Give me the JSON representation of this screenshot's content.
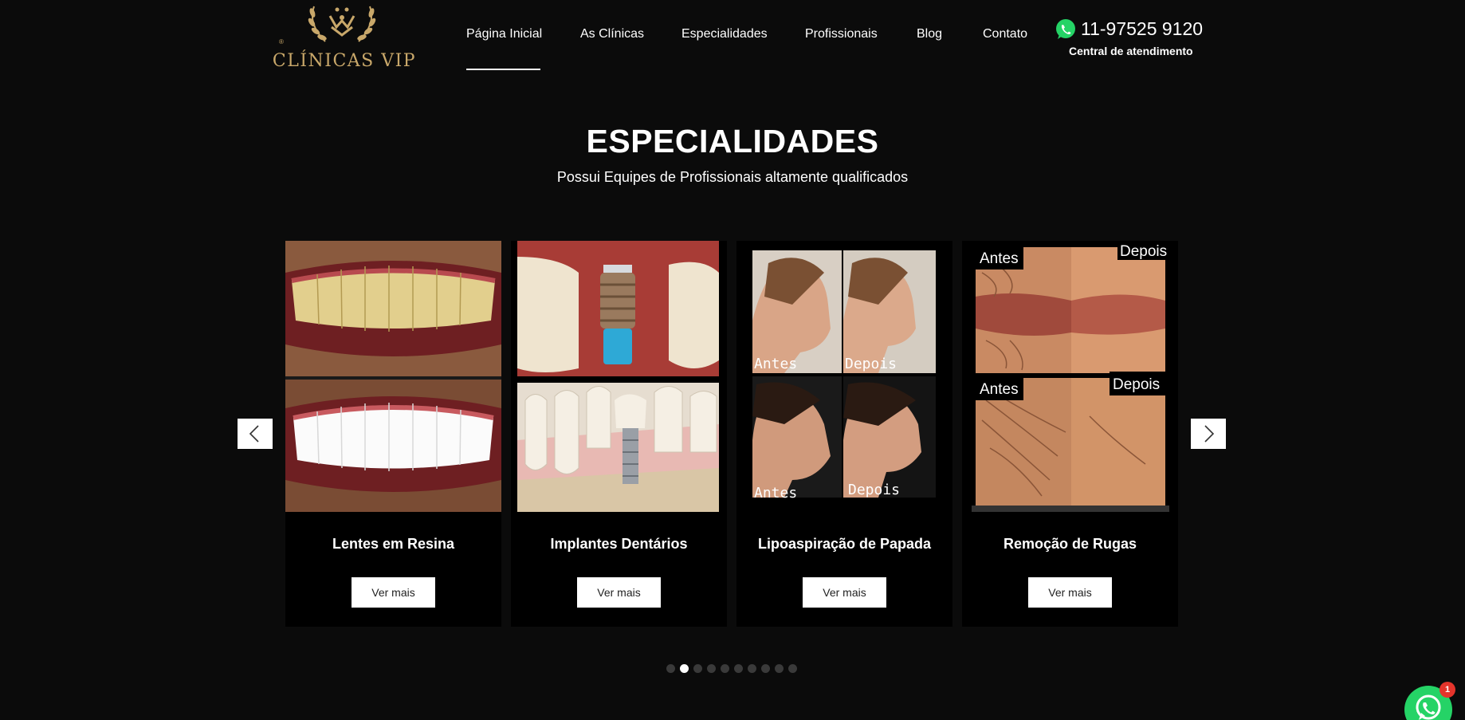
{
  "header": {
    "logo_text": "CLÍNICAS VIP",
    "logo_reg": "®",
    "nav": [
      {
        "label": "Página Inicial",
        "active": true
      },
      {
        "label": "As Clínicas",
        "active": false
      },
      {
        "label": "Especialidades",
        "active": false
      },
      {
        "label": "Profissionais",
        "active": false
      },
      {
        "label": "Blog",
        "active": false
      },
      {
        "label": "Contato",
        "active": false
      }
    ],
    "phone": "11-97525 9120",
    "phone_caption": "Central de atendimento"
  },
  "section": {
    "title": "ESPECIALIDADES",
    "subtitle": "Possui Equipes de Profissionais altamente qualificados"
  },
  "carousel": {
    "cards": [
      {
        "title": "Lentes em Resina",
        "button": "Ver mais"
      },
      {
        "title": "Implantes Dentários",
        "button": "Ver mais"
      },
      {
        "title": "Lipoaspiração de Papada",
        "button": "Ver mais",
        "image_labels": [
          "Antes",
          "Depois",
          "Antes",
          "Depois"
        ]
      },
      {
        "title": "Remoção de Rugas",
        "button": "Ver mais",
        "image_labels": [
          "Antes",
          "Depois",
          "Antes",
          "Depois"
        ]
      }
    ],
    "dots_total": 10,
    "dot_active_index": 1,
    "icons": {
      "prev": "chevron-left-icon",
      "next": "chevron-right-icon"
    }
  },
  "floating_chat": {
    "icon": "whatsapp-icon",
    "badge": "1"
  },
  "colors": {
    "background": "#0b0b0b",
    "gold": "#c9a86a",
    "whatsapp": "#25d366",
    "badge": "#e4342b"
  }
}
